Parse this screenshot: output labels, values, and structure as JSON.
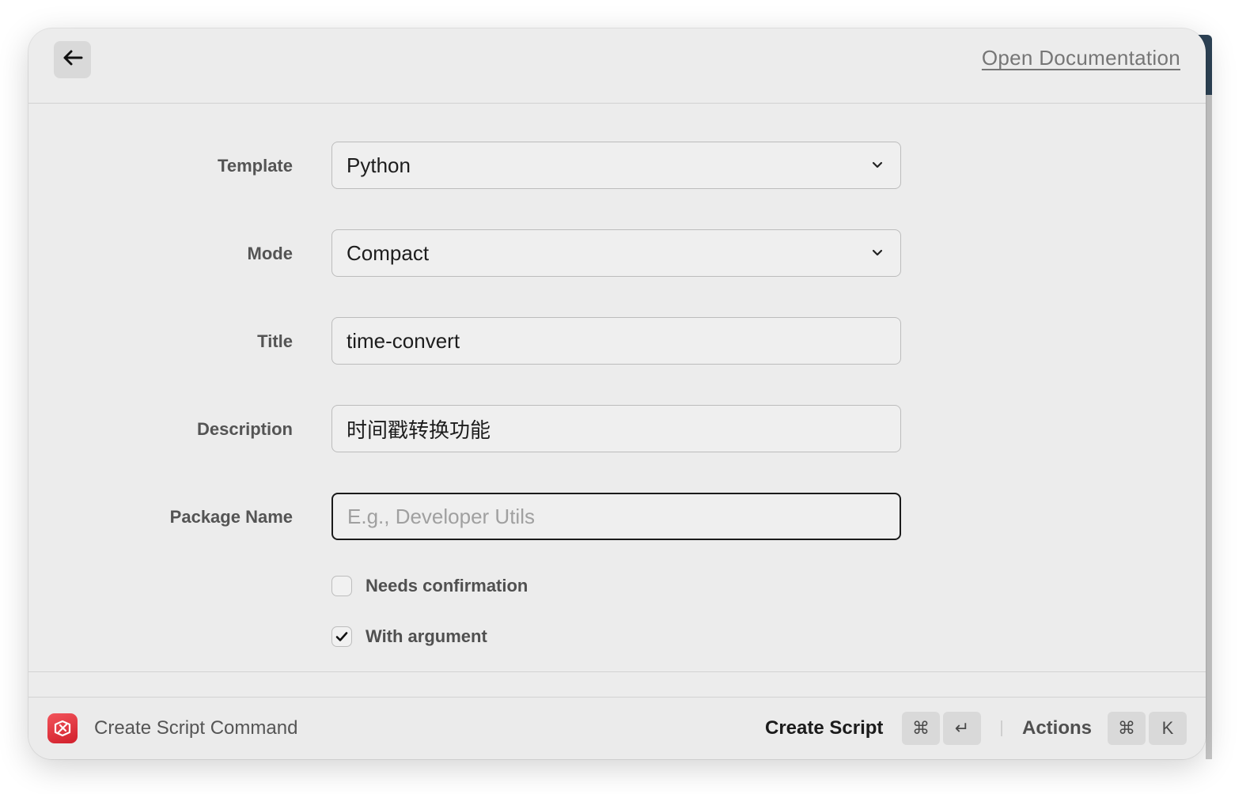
{
  "header": {
    "back_icon": "arrow-left-icon",
    "doc_link": "Open Documentation"
  },
  "form": {
    "template": {
      "label": "Template",
      "value": "Python"
    },
    "mode": {
      "label": "Mode",
      "value": "Compact"
    },
    "title": {
      "label": "Title",
      "value": "time-convert"
    },
    "description": {
      "label": "Description",
      "value": "时间戳转换功能"
    },
    "package_name": {
      "label": "Package Name",
      "value": "",
      "placeholder": "E.g., Developer Utils"
    },
    "needs_confirmation": {
      "label": "Needs confirmation",
      "checked": false
    },
    "with_argument": {
      "label": "With argument",
      "checked": true
    }
  },
  "footer": {
    "title": "Create Script Command",
    "primary_action": "Create Script",
    "primary_keys": [
      "⌘",
      "↵"
    ],
    "actions_label": "Actions",
    "actions_keys": [
      "⌘",
      "K"
    ],
    "app_icon_color": "#e2333c"
  }
}
